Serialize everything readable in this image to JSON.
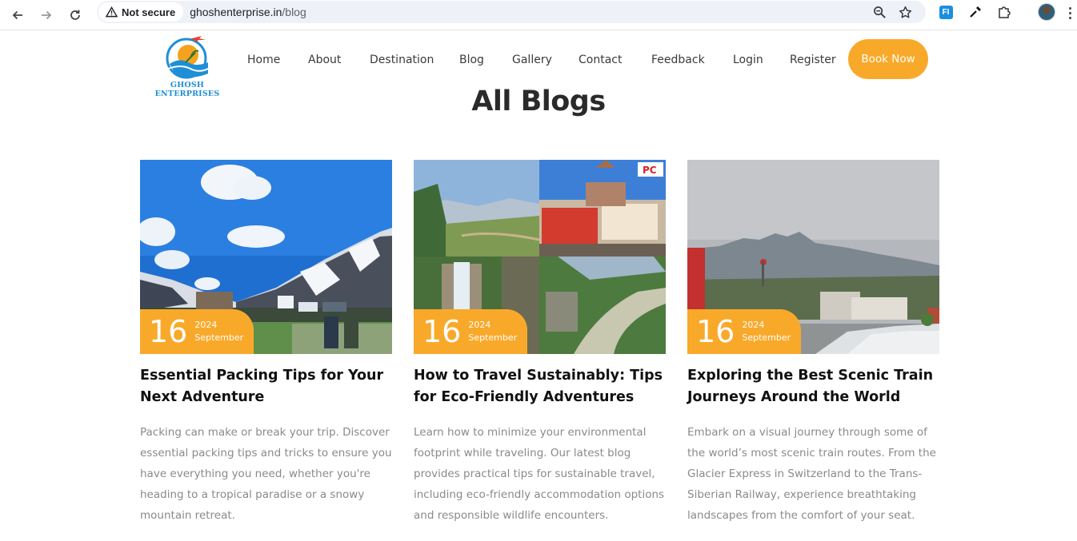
{
  "browser": {
    "security_label": "Not secure",
    "url_host": "ghoshenterprise.in",
    "url_path": "/blog",
    "icons": [
      "back-icon",
      "forward-icon",
      "reload-icon",
      "warning-icon",
      "zoom-icon",
      "star-icon",
      "extension-icon",
      "eyedropper-icon",
      "puzzle-icon",
      "profile-avatar",
      "menu-icon"
    ],
    "extension_badge": "FI"
  },
  "site": {
    "logo_text": "GHOSH ENTERPRISES",
    "nav": [
      "Home",
      "About",
      "Destination",
      "Blog",
      "Gallery",
      "Contact",
      "Feedback",
      "Login",
      "Register"
    ],
    "cta": "Book Now",
    "accent_color": "#f9a92a"
  },
  "page": {
    "title": "All Blogs"
  },
  "posts": [
    {
      "day": "16",
      "year": "2024",
      "month": "September",
      "title": "Essential Packing Tips for Your Next Adventure",
      "excerpt": "Packing can make or break your trip. Discover essential packing tips and tricks to ensure you have everything you need, whether you're heading to a tropical paradise or a snowy mountain retreat."
    },
    {
      "day": "16",
      "year": "2024",
      "month": "September",
      "title": "How to Travel Sustainably: Tips for Eco-Friendly Adventures",
      "excerpt": "Learn how to minimize your environmental footprint while traveling. Our latest blog provides practical tips for sustainable travel, including eco-friendly accommodation options and responsible wildlife encounters."
    },
    {
      "day": "16",
      "year": "2024",
      "month": "September",
      "title": "Exploring the Best Scenic Train Journeys Around the World",
      "excerpt": "Embark on a visual journey through some of the world’s most scenic train routes. From the Glacier Express in Switzerland to the Trans-Siberian Railway, experience breathtaking landscapes from the comfort of your seat."
    }
  ]
}
